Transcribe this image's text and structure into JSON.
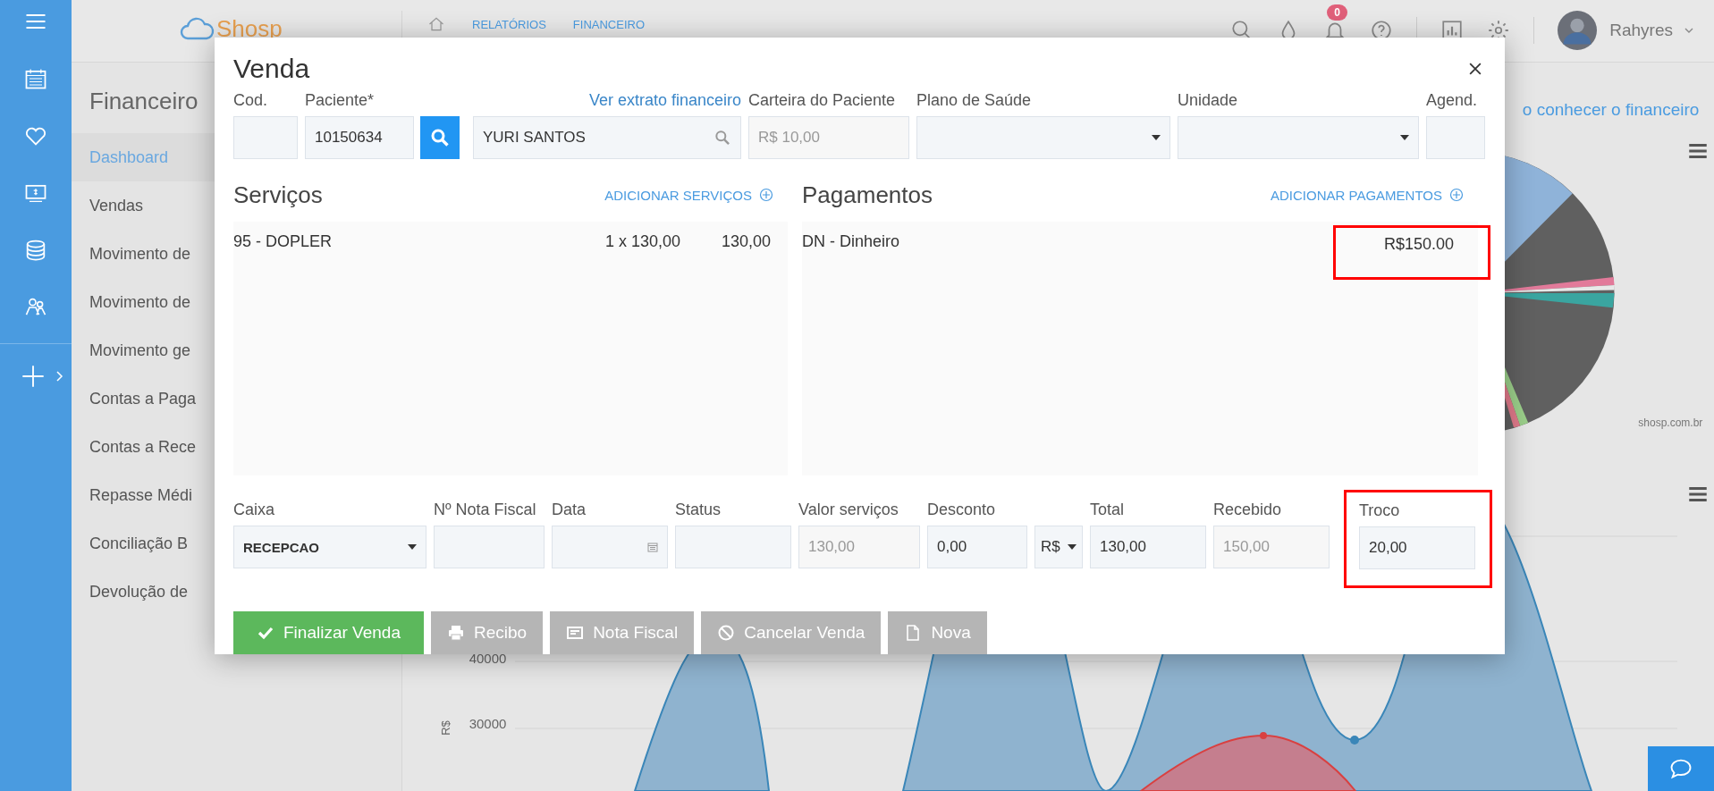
{
  "topbar": {
    "logo": "Shosp",
    "breadcrumb": [
      "RELATÓRIOS",
      "FINANCEIRO"
    ],
    "notification_count": "0",
    "user": "Rahyres"
  },
  "sidebar": {
    "title": "Financeiro",
    "items": [
      {
        "label": "Dashboard",
        "selected": true
      },
      {
        "label": "Vendas",
        "selected": false
      },
      {
        "label": "Movimento de",
        "selected": false
      },
      {
        "label": "Movimento de",
        "selected": false
      },
      {
        "label": "Movimento ge",
        "selected": false
      },
      {
        "label": "Contas a Paga",
        "selected": false
      },
      {
        "label": "Contas a Rece",
        "selected": false
      },
      {
        "label": "Repasse Médi",
        "selected": false
      },
      {
        "label": "Conciliação B",
        "selected": false
      },
      {
        "label": "Devolução de",
        "selected": false
      }
    ]
  },
  "content": {
    "help_link": "o conhecer o financeiro",
    "pie_source": "shosp.com.br",
    "area_chart": {
      "y_label": "R$",
      "y_ticks": [
        "40000",
        "30000"
      ]
    }
  },
  "modal": {
    "title": "Venda",
    "header_fields": [
      {
        "kind": "text",
        "label": "Cod."
      },
      {
        "kind": "patient",
        "label": "Paciente*",
        "value": "10150634"
      },
      {
        "kind": "search",
        "link": "Ver extrato financeiro",
        "value": "YURI SANTOS"
      },
      {
        "kind": "readonly",
        "label": "Carteira do Paciente",
        "value": "R$ 10,00"
      },
      {
        "kind": "select",
        "label": "Plano de Saúde"
      },
      {
        "kind": "select",
        "label": "Unidade"
      },
      {
        "kind": "text",
        "label": "Agend."
      }
    ],
    "services": {
      "title": "Serviços",
      "add_link": "ADICIONAR SERVIÇOS",
      "rows": [
        {
          "item": "95 - DOPLER",
          "quantity": "1 x 130,00",
          "total": "130,00"
        }
      ]
    },
    "payments": {
      "title": "Pagamentos",
      "add_link": "ADICIONAR PAGAMENTOS",
      "rows": [
        {
          "method": "DN - Dinheiro",
          "amount": "R$150.00",
          "highlighted": true
        }
      ]
    },
    "footer_fields": [
      {
        "kind": "select",
        "label": "Caixa",
        "value": "RECEPCAO"
      },
      {
        "kind": "text",
        "label": "Nº Nota Fiscal"
      },
      {
        "kind": "date",
        "label": "Data"
      },
      {
        "kind": "text",
        "label": "Status"
      },
      {
        "kind": "readonly",
        "label": "Valor serviços",
        "value": "130,00"
      },
      {
        "kind": "text",
        "label": "Desconto",
        "value": "0,00"
      },
      {
        "kind": "unit",
        "value": "R$"
      },
      {
        "kind": "text",
        "label": "Total",
        "value": "130,00"
      },
      {
        "kind": "readonly",
        "label": "Recebido",
        "value": "150,00"
      },
      {
        "kind": "text",
        "label": "Troco",
        "value": "20,00",
        "highlighted": true
      }
    ],
    "buttons": [
      {
        "kind": "finalize",
        "label": "Finalizar Venda"
      },
      {
        "kind": "print",
        "label": "Recibo"
      },
      {
        "kind": "invoice",
        "label": "Nota Fiscal"
      },
      {
        "kind": "cancel",
        "label": "Cancelar Venda"
      },
      {
        "kind": "new",
        "label": "Nova"
      }
    ]
  }
}
